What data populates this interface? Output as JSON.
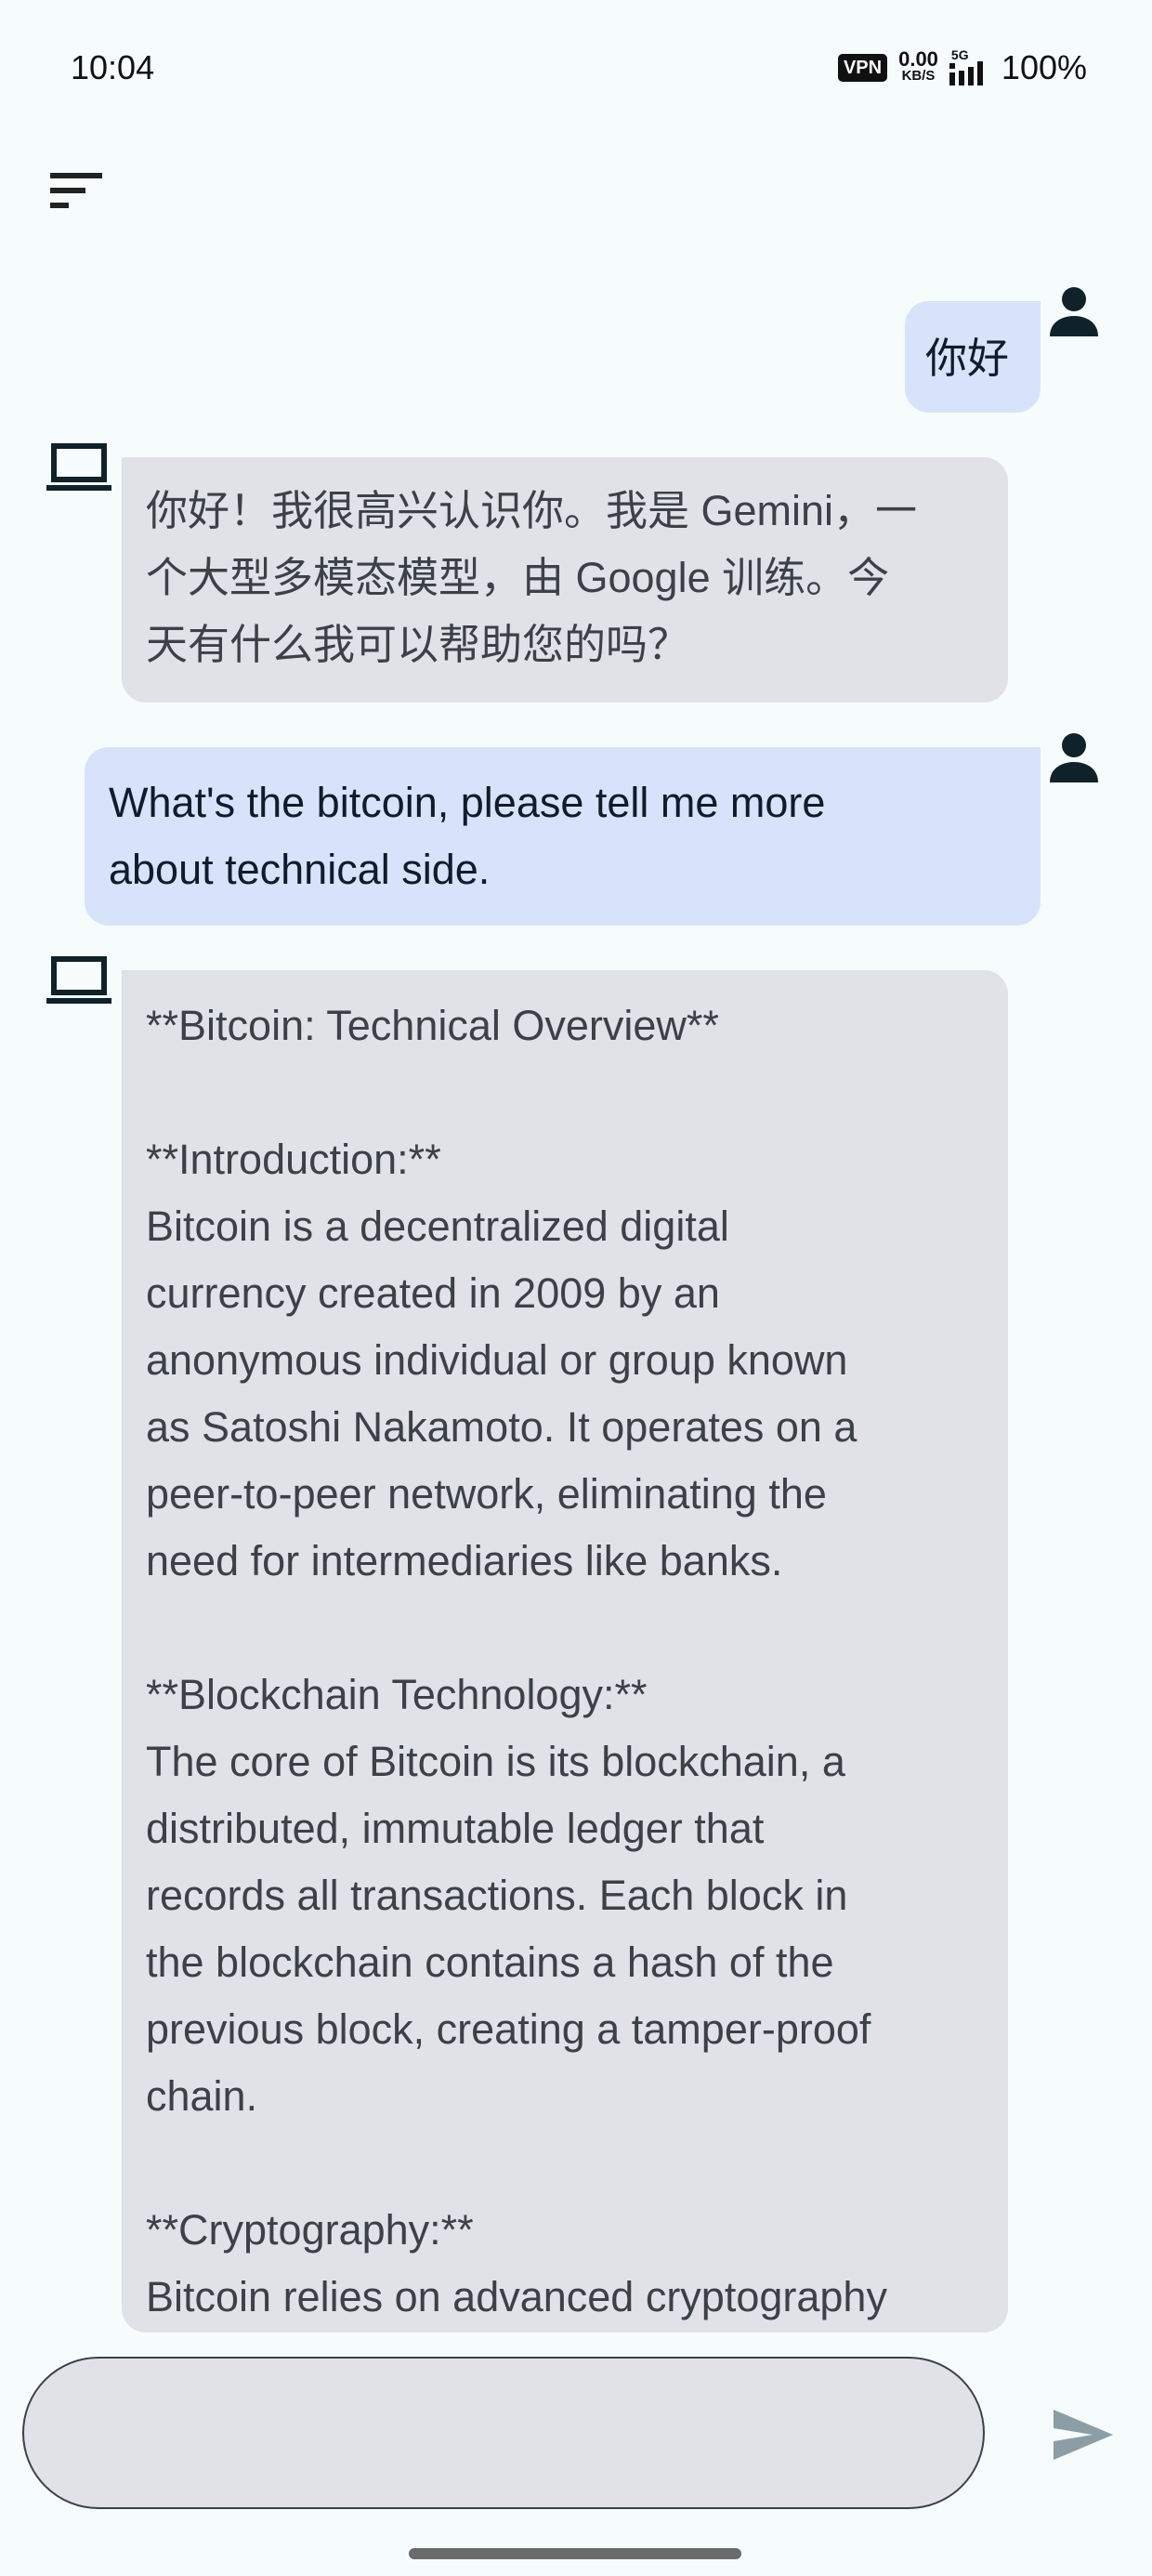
{
  "status_bar": {
    "time": "10:04",
    "vpn": "VPN",
    "net_speed": "0.00",
    "net_unit": "KB/S",
    "network_type": "5G",
    "battery": "100%",
    "icons": [
      "vpn-icon",
      "signal-icon"
    ]
  },
  "header": {
    "menu_icon": "sort-menu-icon"
  },
  "chat": {
    "messages": [
      {
        "role": "user",
        "avatar_icon": "person-icon",
        "text": "你好"
      },
      {
        "role": "model",
        "avatar_icon": "laptop-icon",
        "text": "你好！我很高兴认识你。我是 Gemini，一\n个大型多模态模型，由 Google 训练。今\n天有什么我可以帮助您的吗？"
      },
      {
        "role": "user",
        "avatar_icon": "person-icon",
        "text": "What's the bitcoin, please tell me more\nabout technical side."
      },
      {
        "role": "model",
        "avatar_icon": "laptop-icon",
        "text": "**Bitcoin: Technical Overview**\n\n**Introduction:**\nBitcoin is a decentralized digital\ncurrency created in 2009 by an\nanonymous individual or group known\nas Satoshi Nakamoto. It operates on a\npeer-to-peer network, eliminating the\nneed for intermediaries like banks.\n\n**Blockchain Technology:**\nThe core of Bitcoin is its blockchain, a\ndistributed, immutable ledger that\nrecords all transactions. Each block in\nthe blockchain contains a hash of the\nprevious block, creating a tamper-proof\nchain.\n\n**Cryptography:**\nBitcoin relies on advanced cryptography"
      }
    ]
  },
  "input": {
    "value": "",
    "placeholder": "",
    "send_icon": "send-icon"
  },
  "colors": {
    "background": "#f6fbfc",
    "user_bubble": "#d6e3fb",
    "model_bubble": "#e0e2e8",
    "icon_dark": "#0f2229",
    "send_icon": "#8c9ea5"
  }
}
